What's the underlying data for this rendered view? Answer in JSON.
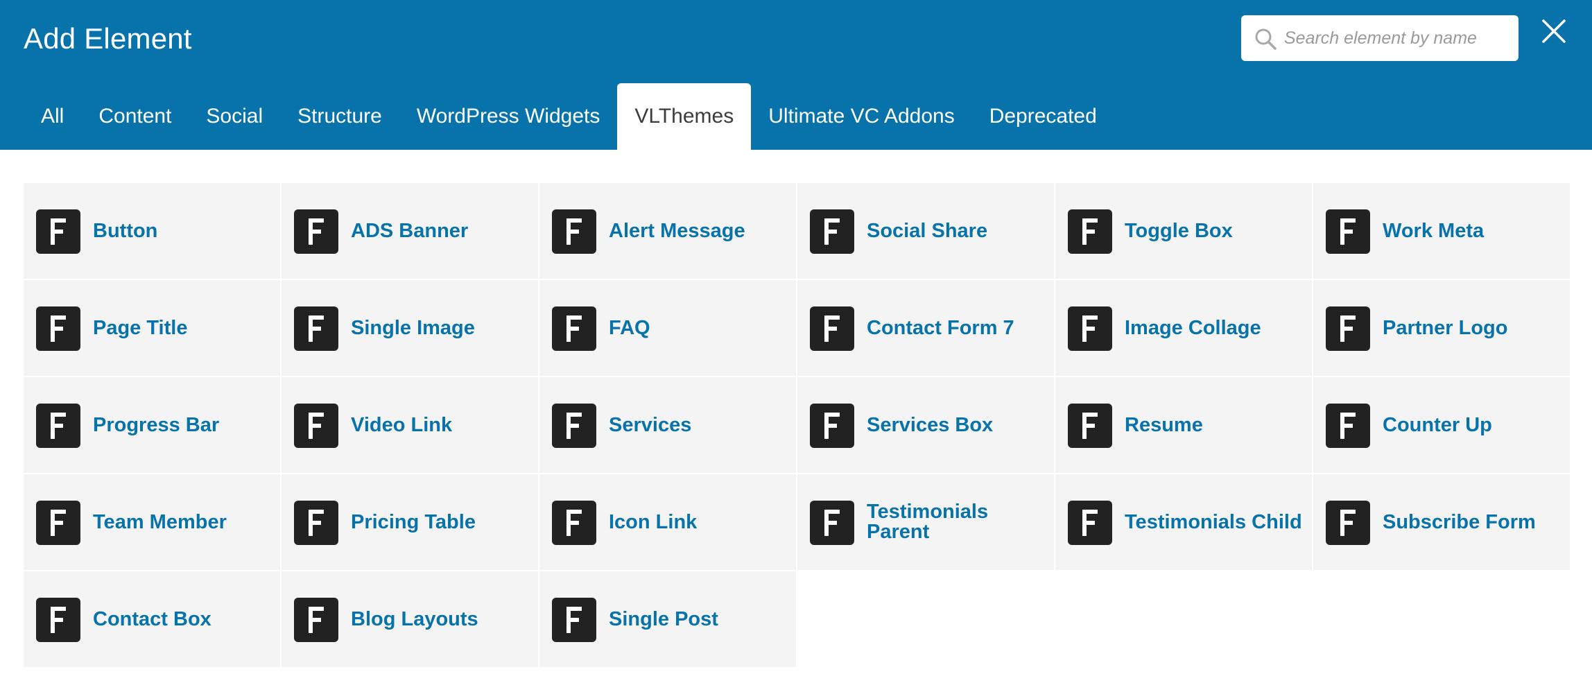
{
  "header": {
    "title": "Add Element",
    "search_placeholder": "Search element by name",
    "search_icon": "search-icon",
    "close_icon": "close-icon"
  },
  "colors": {
    "header_bg": "#0873aa",
    "label": "#0873aa",
    "icon_bg": "#222222",
    "cell_bg": "#f4f4f4"
  },
  "tabs": [
    {
      "label": "All",
      "active": false
    },
    {
      "label": "Content",
      "active": false
    },
    {
      "label": "Social",
      "active": false
    },
    {
      "label": "Structure",
      "active": false
    },
    {
      "label": "WordPress Widgets",
      "active": false
    },
    {
      "label": "VLThemes",
      "active": true
    },
    {
      "label": "Ultimate VC Addons",
      "active": false
    },
    {
      "label": "Deprecated",
      "active": false
    }
  ],
  "elements": [
    {
      "label": "Button",
      "icon": "F"
    },
    {
      "label": "ADS Banner",
      "icon": "F"
    },
    {
      "label": "Alert Message",
      "icon": "F"
    },
    {
      "label": "Social Share",
      "icon": "F"
    },
    {
      "label": "Toggle Box",
      "icon": "F"
    },
    {
      "label": "Work Meta",
      "icon": "F"
    },
    {
      "label": "Page Title",
      "icon": "F"
    },
    {
      "label": "Single Image",
      "icon": "F"
    },
    {
      "label": "FAQ",
      "icon": "F"
    },
    {
      "label": "Contact Form 7",
      "icon": "F"
    },
    {
      "label": "Image Collage",
      "icon": "F"
    },
    {
      "label": "Partner Logo",
      "icon": "F"
    },
    {
      "label": "Progress Bar",
      "icon": "F"
    },
    {
      "label": "Video Link",
      "icon": "F"
    },
    {
      "label": "Services",
      "icon": "F"
    },
    {
      "label": "Services Box",
      "icon": "F"
    },
    {
      "label": "Resume",
      "icon": "F"
    },
    {
      "label": "Counter Up",
      "icon": "F"
    },
    {
      "label": "Team Member",
      "icon": "F"
    },
    {
      "label": "Pricing Table",
      "icon": "F"
    },
    {
      "label": "Icon Link",
      "icon": "F"
    },
    {
      "label": "Testimonials Parent",
      "icon": "F"
    },
    {
      "label": "Testimonials Child",
      "icon": "F"
    },
    {
      "label": "Subscribe Form",
      "icon": "F"
    },
    {
      "label": "Contact Box",
      "icon": "F"
    },
    {
      "label": "Blog Layouts",
      "icon": "F"
    },
    {
      "label": "Single Post",
      "icon": "F"
    }
  ]
}
